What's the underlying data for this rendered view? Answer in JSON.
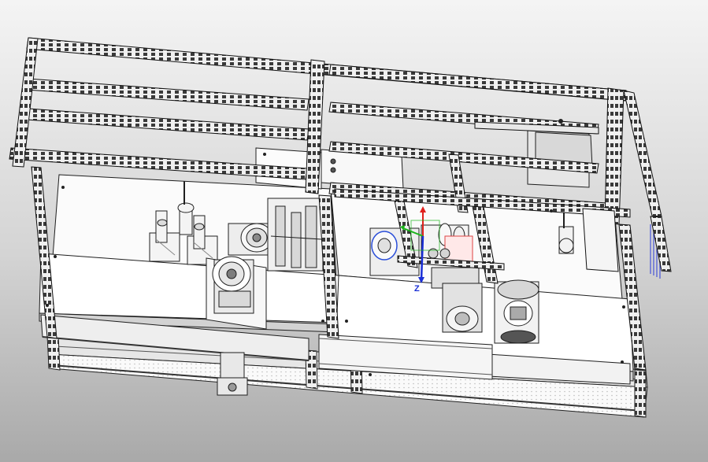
{
  "viewport": {
    "background_top": "#f4f4f4",
    "background_bottom": "#a9a9a9",
    "content": "cad-3d-assembly-model"
  },
  "triad": {
    "z_label": "Z",
    "colors": {
      "x": "#e0201c",
      "y": "#18b418",
      "z": "#1a2fd6"
    }
  }
}
